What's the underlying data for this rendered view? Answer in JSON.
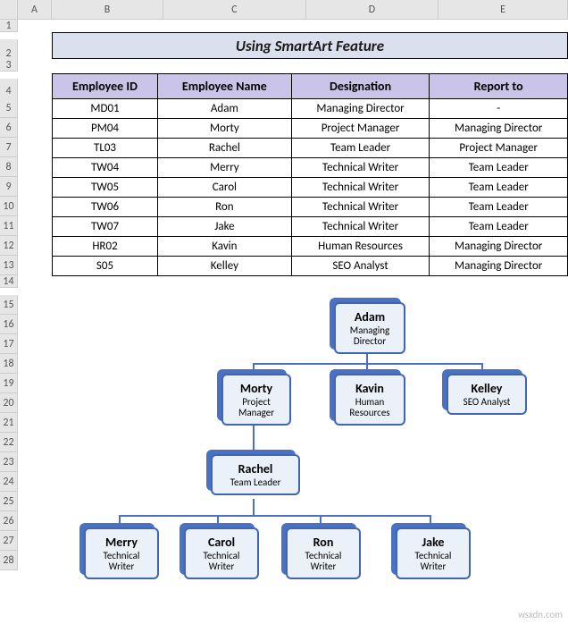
{
  "columns": [
    "A",
    "B",
    "C",
    "D",
    "E"
  ],
  "rows": [
    "1",
    "2",
    "3",
    "4",
    "5",
    "6",
    "7",
    "8",
    "9",
    "10",
    "11",
    "12",
    "13",
    "14",
    "15",
    "16",
    "17",
    "18",
    "19",
    "20",
    "21",
    "22",
    "23",
    "24",
    "25",
    "26",
    "27",
    "28"
  ],
  "title": "Using SmartArt Feature",
  "table": {
    "headers": [
      "Employee ID",
      "Employee Name",
      "Designation",
      "Report to"
    ],
    "data": [
      [
        "MD01",
        "Adam",
        "Managing Director",
        "-"
      ],
      [
        "PM04",
        "Morty",
        "Project Manager",
        "Managing Director"
      ],
      [
        "TL03",
        "Rachel",
        "Team Leader",
        "Project Manager"
      ],
      [
        "TW04",
        "Merry",
        "Technical Writer",
        "Team Leader"
      ],
      [
        "TW05",
        "Carol",
        "Technical Writer",
        "Team Leader"
      ],
      [
        "TW06",
        "Ron",
        "Technical Writer",
        "Team Leader"
      ],
      [
        "TW07",
        "Jake",
        "Technical Writer",
        "Team Leader"
      ],
      [
        "HR02",
        "Kavin",
        "Human Resources",
        "Managing Director"
      ],
      [
        "S05",
        "Kelley",
        "SEO Analyst",
        "Managing Director"
      ]
    ]
  },
  "org": {
    "adam": {
      "name": "Adam",
      "role": "Managing\nDirector"
    },
    "morty": {
      "name": "Morty",
      "role": "Project\nManager"
    },
    "kavin": {
      "name": "Kavin",
      "role": "Human\nResources"
    },
    "kelley": {
      "name": "Kelley",
      "role": "SEO Analyst"
    },
    "rachel": {
      "name": "Rachel",
      "role": "Team Leader"
    },
    "merry": {
      "name": "Merry",
      "role": "Technical\nWriter"
    },
    "carol": {
      "name": "Carol",
      "role": "Technical\nWriter"
    },
    "ron": {
      "name": "Ron",
      "role": "Technical\nWriter"
    },
    "jake": {
      "name": "Jake",
      "role": "Technical\nWriter"
    }
  },
  "watermark": "wsxdn.com"
}
